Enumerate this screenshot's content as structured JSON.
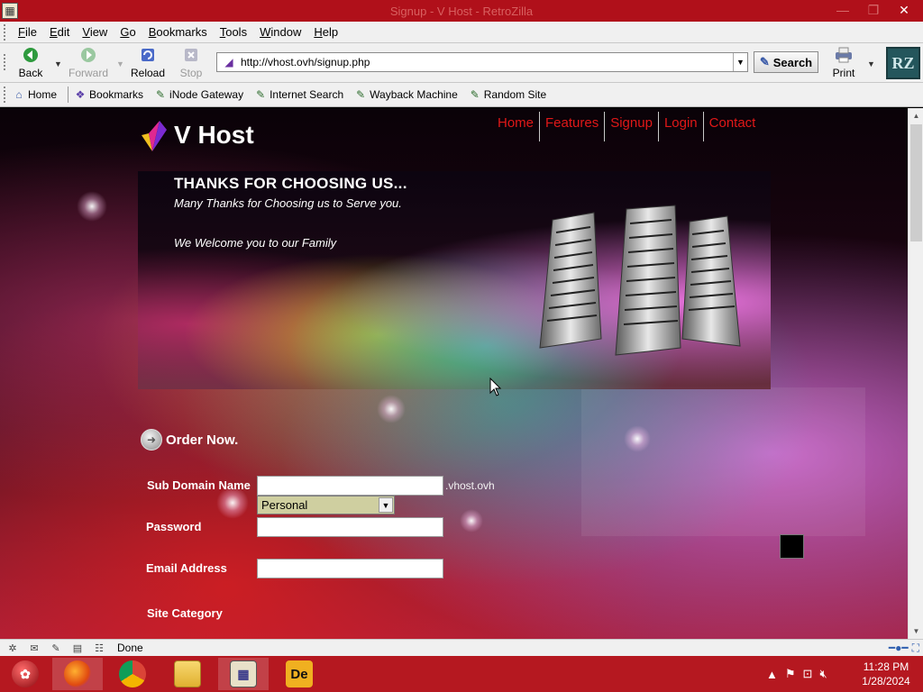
{
  "window": {
    "title": "Signup - V Host - RetroZilla",
    "minimize": "—",
    "maximize": "❐",
    "close": "✕"
  },
  "menu": [
    {
      "label": "File",
      "underline": "F",
      "rest": "ile"
    },
    {
      "label": "Edit",
      "underline": "E",
      "rest": "dit"
    },
    {
      "label": "View",
      "underline": "V",
      "rest": "iew"
    },
    {
      "label": "Go",
      "underline": "G",
      "rest": "o"
    },
    {
      "label": "Bookmarks",
      "underline": "B",
      "rest": "ookmarks"
    },
    {
      "label": "Tools",
      "underline": "T",
      "rest": "ools"
    },
    {
      "label": "Window",
      "underline": "W",
      "rest": "indow"
    },
    {
      "label": "Help",
      "underline": "H",
      "rest": "elp"
    }
  ],
  "nav": {
    "back": "Back",
    "forward": "Forward",
    "reload": "Reload",
    "stop": "Stop",
    "url": "http://vhost.ovh/signup.php",
    "search": "Search",
    "print": "Print",
    "brand": "RZ"
  },
  "bookmarks": {
    "home": "Home",
    "bookmarks": "Bookmarks",
    "items": [
      "iNode Gateway",
      "Internet Search",
      "Wayback Machine",
      "Random Site"
    ]
  },
  "site": {
    "logo": "V Host",
    "nav": [
      "Home",
      "Features",
      "Signup",
      "Login",
      "Contact"
    ],
    "banner": {
      "heading": "THANKS FOR CHOOSING US...",
      "line1": "Many Thanks for Choosing us to Serve you.",
      "line2": "We Welcome you to our Family"
    },
    "order_now": "Order Now.",
    "form": {
      "subdomain_label": "Sub Domain Name",
      "subdomain_suffix": ".vhost.ovh",
      "password_label": "Password",
      "email_label": "Email Address",
      "category_label": "Site Category",
      "category_value": "Personal"
    }
  },
  "status": {
    "text": "Done"
  },
  "taskbar": {
    "time": "11:28 PM",
    "date": "1/28/2024",
    "active_app": "RetroZilla"
  },
  "colors": {
    "titlebar": "#b0101a",
    "site_nav": "#e01818",
    "taskbar": "#b51820"
  }
}
